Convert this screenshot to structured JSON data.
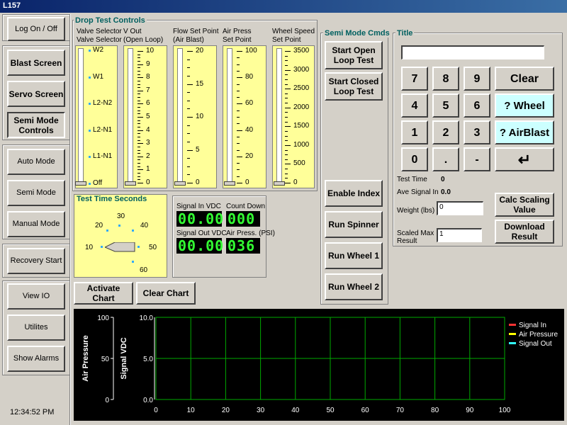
{
  "window_title": "L157",
  "sidebar": {
    "log_on_off": "Log On / Off",
    "blast_screen": "Blast Screen",
    "servo_screen": "Servo Screen",
    "semi_mode_controls": "Semi Mode Controls",
    "auto_mode": "Auto Mode",
    "semi_mode": "Semi Mode",
    "manual_mode": "Manual Mode",
    "recovery_start": "Recovery Start",
    "view_io": "View IO",
    "utilities": "Utilites",
    "show_alarms": "Show Alarms",
    "clock": "12:34:52 PM"
  },
  "drop_test": {
    "title": "Drop Test Controls",
    "valve": {
      "head1": "Valve Selector",
      "head2": "Valve Selector",
      "labels": [
        "W2",
        "W1",
        "L2-N2",
        "L2-N1",
        "L1-N1",
        "Off"
      ]
    },
    "vout": {
      "head1": "V Out",
      "head2": "(Open Loop)",
      "labels": [
        "10",
        "9",
        "8",
        "7",
        "6",
        "5",
        "4",
        "3",
        "2",
        "1",
        "0"
      ],
      "value": 0
    },
    "flow": {
      "head1": "Flow Set Point",
      "head2": "(Air Blast)",
      "labels": [
        "20",
        "15",
        "10",
        "5",
        "0"
      ],
      "value": 0
    },
    "air": {
      "head1": "Air Press",
      "head2": "Set Point",
      "labels": [
        "100",
        "80",
        "60",
        "40",
        "20",
        "0"
      ],
      "value": 0
    },
    "wheel": {
      "head1": "Wheel Speed",
      "head2": "Set Point",
      "labels": [
        "3500",
        "3000",
        "2500",
        "2000",
        "1500",
        "1000",
        "500",
        "0"
      ],
      "value": 0
    }
  },
  "test_time": {
    "title": "Test Time Seconds",
    "labels": [
      "10",
      "20",
      "30",
      "40",
      "50",
      "60"
    ]
  },
  "readouts": {
    "signal_in_label": "Signal In VDC",
    "signal_in_value": "00.00",
    "count_down_label": "Count Down",
    "count_down_value": "000",
    "signal_out_label": "Signal Out VDC",
    "signal_out_value": "00.00",
    "air_press_label": "Air Press. (PSI)",
    "air_press_value": "036"
  },
  "buttons": {
    "activate_chart": "Activate Chart",
    "clear_chart": "Clear Chart"
  },
  "semi_mode": {
    "title": "Semi Mode Cmds",
    "start_open": "Start Open Loop Test",
    "start_closed": "Start Closed Loop Test",
    "enable_index": "Enable Index",
    "run_spinner": "Run Spinner",
    "run_wheel_1": "Run Wheel 1",
    "run_wheel_2": "Run Wheel 2"
  },
  "keypad": {
    "title": "Title",
    "title_value": "",
    "keys": [
      "7",
      "8",
      "9",
      "4",
      "5",
      "6",
      "1",
      "2",
      "3",
      "0",
      ".",
      "-"
    ],
    "clear": "Clear",
    "wheel": "? Wheel",
    "airblast": "? AirBlast",
    "enter": "↵"
  },
  "stats": {
    "test_time_label": "Test Time",
    "test_time_value": "0",
    "ave_signal_label": "Ave Signal In",
    "ave_signal_value": "0.0",
    "weight_label": "Weight (lbs)",
    "weight_value": "0",
    "scaled_max_label": "Scaled Max Result",
    "scaled_max_value": "1",
    "calc_scaling": "Calc Scaling Value",
    "download": "Download Result"
  },
  "chart": {
    "y1_label": "Air Pressure",
    "y2_label": "Signal  VDC",
    "y1_ticks": [
      "100",
      "50",
      "0"
    ],
    "y2_ticks": [
      "10.0",
      "5.0",
      "0.0"
    ],
    "x_ticks": [
      "0",
      "10",
      "20",
      "30",
      "40",
      "50",
      "60",
      "70",
      "80",
      "90",
      "100"
    ],
    "legend": [
      "Signal In",
      "Air Pressure",
      "Signal Out"
    ],
    "colors": {
      "signal_in": "#ff3333",
      "air_pressure": "#ffff00",
      "signal_out": "#33ffff",
      "grid": "#00aa00"
    }
  },
  "chart_data": {
    "type": "line",
    "x": [],
    "series": [
      {
        "name": "Signal In",
        "values": []
      },
      {
        "name": "Air Pressure",
        "values": []
      },
      {
        "name": "Signal Out",
        "values": []
      }
    ],
    "xlim": [
      0,
      100
    ],
    "ylim": [
      0,
      10.0
    ],
    "y2lim": [
      0,
      100
    ],
    "grid": true,
    "legend_position": "right"
  }
}
